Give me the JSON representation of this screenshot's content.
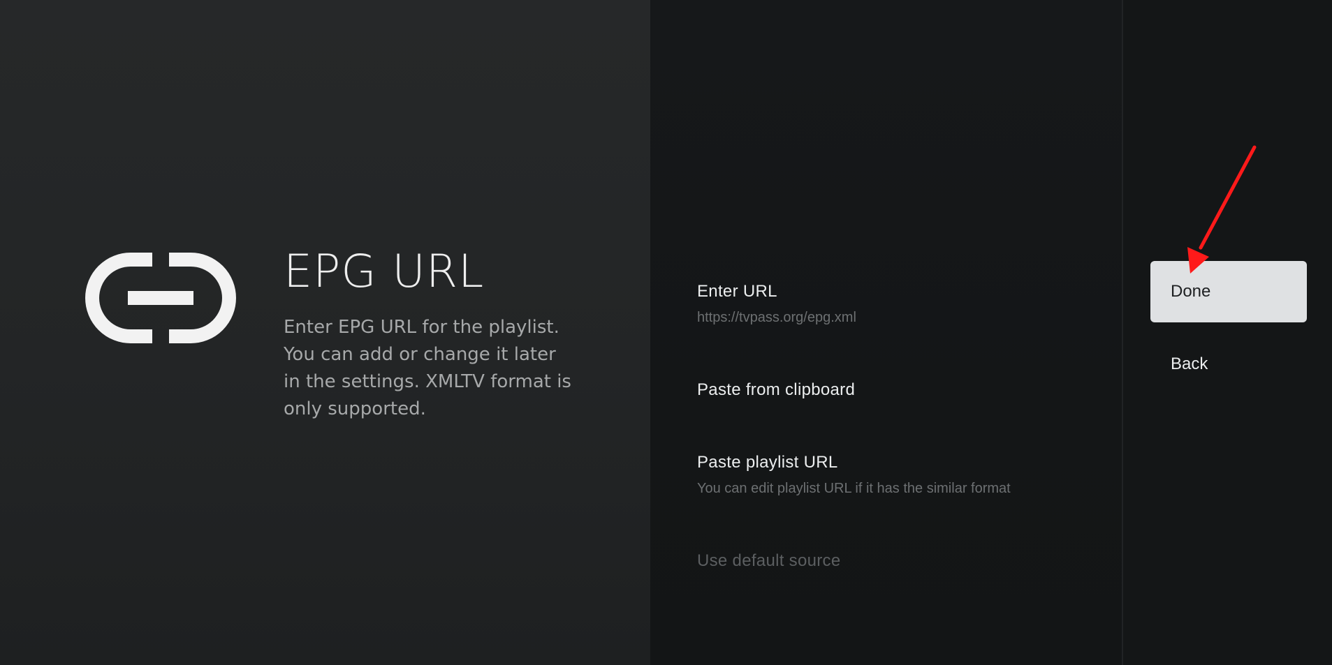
{
  "guidance": {
    "icon": "link-icon",
    "title": "EPG URL",
    "description": "Enter EPG URL for the playlist. You can add or change it later in the settings. XMLTV format is only supported."
  },
  "actions": [
    {
      "title": "Enter URL",
      "description": "https://tvpass.org/epg.xml",
      "enabled": true
    },
    {
      "title": "Paste from clipboard",
      "description": "",
      "enabled": true
    },
    {
      "title": "Paste playlist URL",
      "description": "You can edit playlist URL if it has the similar format",
      "enabled": true
    },
    {
      "title": "Use default source",
      "description": "",
      "enabled": false
    }
  ],
  "buttons": {
    "done_label": "Done",
    "back_label": "Back",
    "focused": "done"
  },
  "annotation": {
    "arrow_color": "#ff1a1a",
    "target": "done-button"
  },
  "colors": {
    "focus_background": "#dfe1e3",
    "panel_left": "#252728",
    "panel_right": "#151718"
  }
}
